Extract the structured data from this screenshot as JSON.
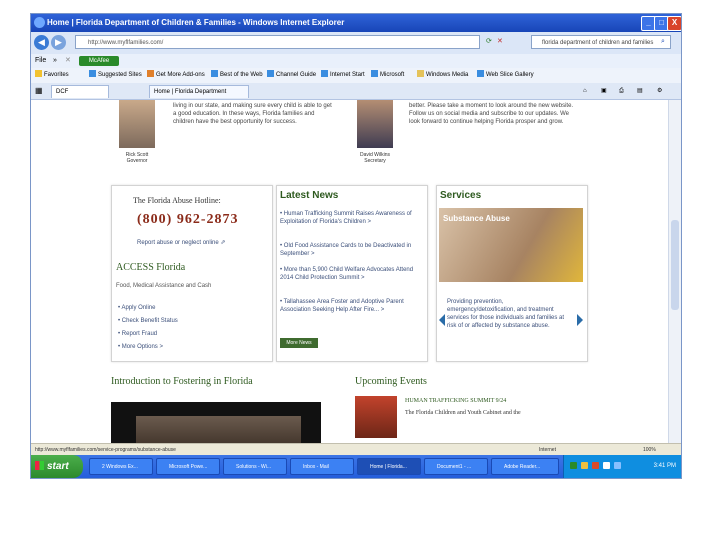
{
  "window": {
    "title": "Home | Florida Department of Children & Families - Windows Internet Explorer",
    "url": "http://www.myflfamilies.com/",
    "search_text": "florida department of children and families",
    "minimize": "_",
    "maximize": "□",
    "close": "X"
  },
  "menu": {
    "file": "File",
    "addon": "McAfee"
  },
  "favorites": [
    "Favorites",
    "Suggested Sites",
    "Get More Add-ons",
    "Best of the Web",
    "Channel Guide",
    "Internet Start",
    "Microsoft",
    "Windows Media",
    "Web Slice Gallery"
  ],
  "tabs": [
    "DCF",
    "Home | Florida Department"
  ],
  "page": {
    "governor_name": "Rick Scott",
    "governor_title": "Governor",
    "secretary_name": "David Wilkins",
    "secretary_title": "Secretary",
    "intro_left": "living in our state, and making sure every child is able to get a good education. In these ways, Florida families and children have the best opportunity for success.",
    "intro_right": "better. Please take a moment to look around the new website. Follow us on social media and subscribe to our updates. We look forward to continue helping Florida prosper and grow.",
    "hotline_title": "The Florida Abuse Hotline:",
    "hotline_phone": "(800) 962-2873",
    "hotline_link": "Report abuse or neglect online",
    "access_title": "ACCESS Florida",
    "access_sub": "Food, Medical Assistance and Cash",
    "access_links": [
      "Apply Online",
      "Check Benefit Status",
      "Report Fraud",
      "More Options >"
    ],
    "news_title": "Latest News",
    "news_items": [
      "Human Trafficking Summit Raises Awareness of Exploitation of Florida's Children >",
      "Old Food Assistance Cards to be Deactivated in September >",
      "More than 5,900 Child Welfare Advocates Attend 2014 Child Protection Summit >",
      "Tallahassee Area Foster and Adoptive Parent Association Seeking Help After Fire... >"
    ],
    "news_more": "More News",
    "services_title": "Services",
    "services_image_label": "Substance Abuse",
    "services_text": "Providing prevention, emergency/detoxification, and treatment services for those individuals and families at risk of or affected by substance abuse.",
    "fostering_title": "Introduction to Fostering in Florida",
    "events_title": "Upcoming Events",
    "event_name": "HUMAN TRAFFICKING SUMMIT 9/24",
    "event_desc": "The Florida Children and Youth Cabinet and the"
  },
  "status": {
    "url": "http://www.myflfamilies.com/service-programs/substance-abuse",
    "zone": "Internet",
    "zoom": "100%"
  },
  "taskbar": {
    "start": "start",
    "items": [
      "2 Windows Ex...",
      "Microsoft Powe...",
      "Solutions - Wi...",
      "Inbox - Mail",
      "Home | Florida...",
      "Document1 - ...",
      "Adobe Reader..."
    ],
    "clock": "3:41 PM"
  },
  "colors": {
    "accent_green": "#2e5a1f",
    "phone_red": "#8b2b1a",
    "xp_blue": "#245edb"
  }
}
